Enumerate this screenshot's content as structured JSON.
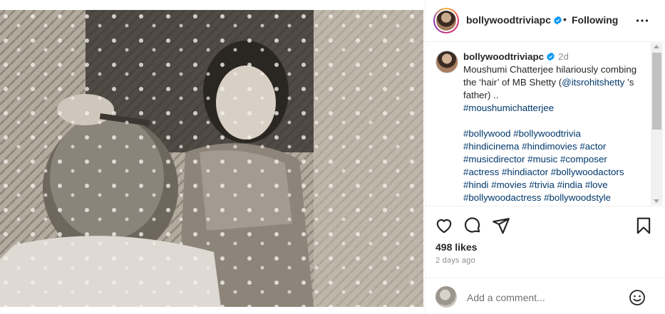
{
  "post": {
    "username": "bollywoodtriviapc",
    "header_separator": "•",
    "follow_status": "Following",
    "caption": {
      "username": "bollywoodtriviapc",
      "time": "2d",
      "line1": "Moushumi Chatterjee hilariously combing the ‘hair’ of MB Shetty (",
      "mention": "@itsrohitshetty",
      "line1_end": " ’s father) ..",
      "hashtag_main": "#moushumichatterjee",
      "hashtags": [
        "#bollywood",
        "#bollywoodtrivia",
        "#hindicinema",
        "#hindimovies",
        "#actor",
        "#musicdirector",
        "#music",
        "#composer",
        "#actress",
        "#hindiactor",
        "#bollywoodactors",
        "#hindi",
        "#movies",
        "#trivia",
        "#india",
        "#love",
        "#bollywoodactress",
        "#bollywoodstyle"
      ]
    },
    "likes": "498 likes",
    "date": "2 days ago",
    "comment_placeholder": "Add a comment..."
  },
  "icons": {
    "verified": "verified-badge-icon",
    "more": "more-options-icon",
    "like": "heart-icon",
    "comment": "comment-icon",
    "share": "share-icon",
    "save": "bookmark-icon",
    "emoji": "emoji-icon"
  },
  "colors": {
    "verified_blue": "#0095f6",
    "link_blue": "#00376b",
    "muted": "#8e8e8e"
  }
}
